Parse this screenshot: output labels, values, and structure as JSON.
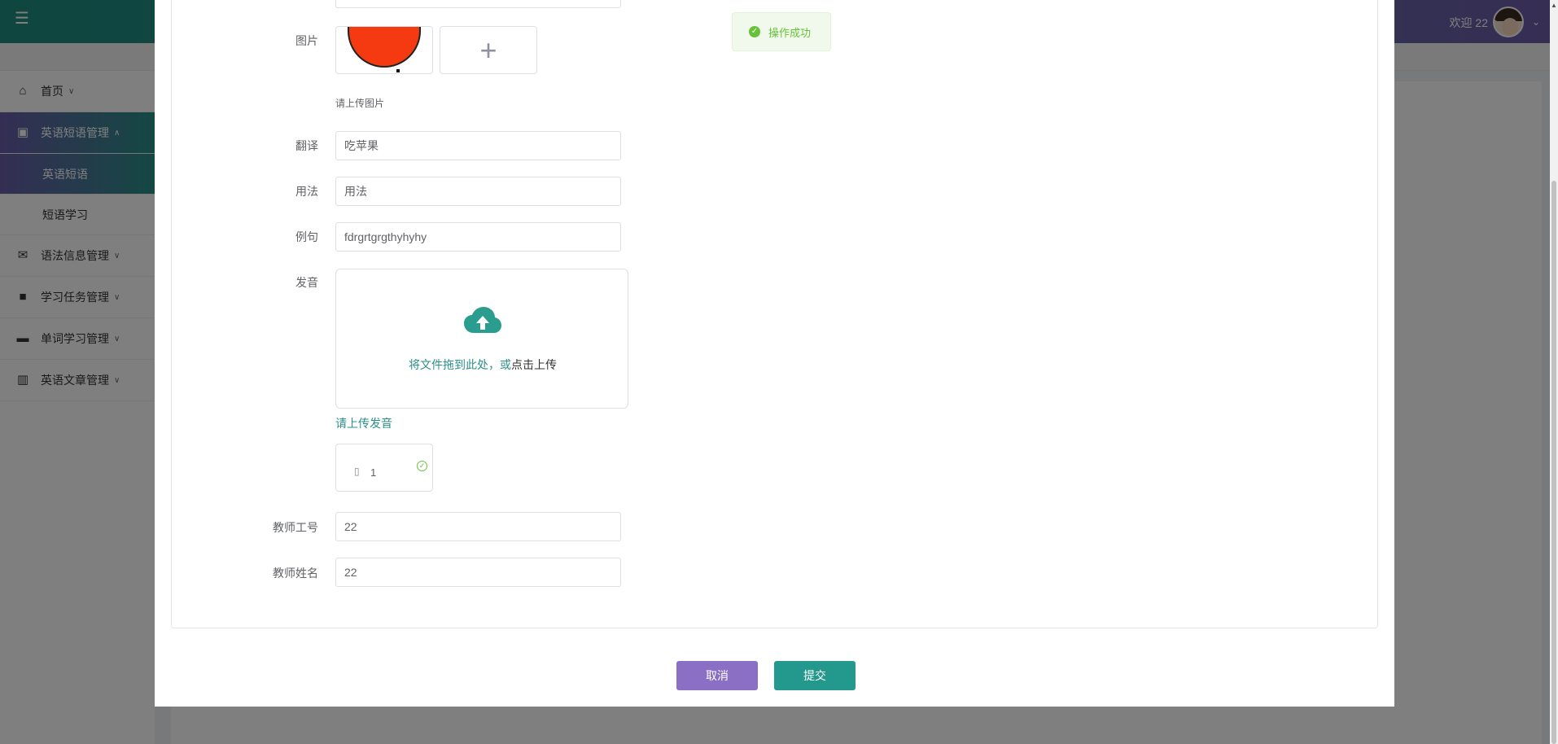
{
  "header": {
    "welcome": "欢迎 22",
    "menu_icon": "menu-fold-icon"
  },
  "sidebar": {
    "items": [
      {
        "label": "首页",
        "icon": "home-icon"
      },
      {
        "label": "英语短语管理",
        "icon": "chip-icon"
      },
      {
        "label": "语法信息管理",
        "icon": "envelope-icon"
      },
      {
        "label": "学习任务管理",
        "icon": "book-icon"
      },
      {
        "label": "单词学习管理",
        "icon": "wallet-icon"
      },
      {
        "label": "英语文章管理",
        "icon": "columns-icon"
      }
    ],
    "sub_items": [
      {
        "label": "英语短语"
      },
      {
        "label": "短语学习"
      }
    ]
  },
  "form": {
    "image_label": "图片",
    "image_hint": "请上传图片",
    "translation_label": "翻译",
    "translation_value": "吃苹果",
    "usage_label": "用法",
    "usage_value": "用法",
    "example_label": "例句",
    "example_value": "fdrgrtgrgthyhyhy",
    "pronunciation_label": "发音",
    "drop_text_main": "将文件拖到此处，或",
    "drop_text_em": "点击上传",
    "upload_hint": "请上传发音",
    "file_name": "1",
    "teacher_id_label": "教师工号",
    "teacher_id_value": "22",
    "teacher_name_label": "教师姓名",
    "teacher_name_value": "22"
  },
  "buttons": {
    "cancel": "取消",
    "submit": "提交"
  },
  "toast": {
    "message": "操作成功",
    "color": "#67c23a"
  },
  "colors": {
    "primary": "#2a8f88",
    "accent_purple": "#6f5ca8",
    "cancel_button": "#8a6fc4",
    "submit_button": "#23998e"
  }
}
